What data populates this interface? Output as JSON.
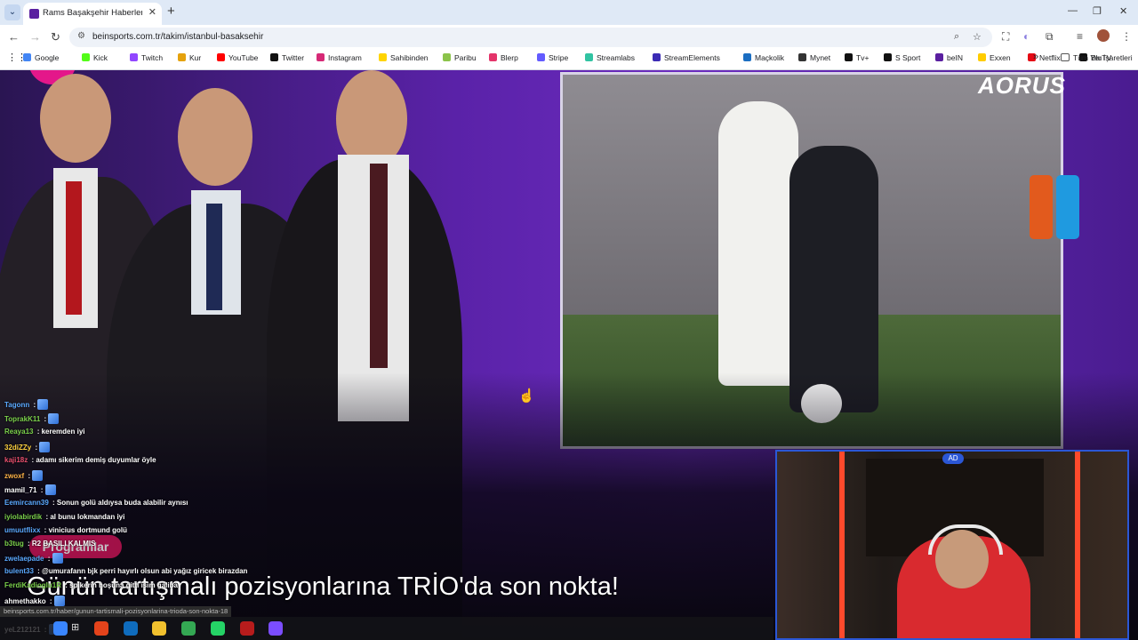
{
  "browser": {
    "tab_title": "Rams Başakşehir Haberleri - Tra",
    "new_tab": "+",
    "url": "beinsports.com.tr/takim/istanbul-basaksehir",
    "bookmarks": [
      {
        "label": "Google",
        "color": "#4285f4"
      },
      {
        "label": "Kick",
        "color": "#53fc18"
      },
      {
        "label": "Twitch",
        "color": "#9146ff"
      },
      {
        "label": "Kur",
        "color": "#e5a20d"
      },
      {
        "label": "YouTube",
        "color": "#ff0000"
      },
      {
        "label": "Twitter",
        "color": "#111111"
      },
      {
        "label": "Instagram",
        "color": "#d62976"
      },
      {
        "label": "Sahibinden",
        "color": "#ffd400"
      },
      {
        "label": "Paribu",
        "color": "#8bc34a"
      },
      {
        "label": "Blerp",
        "color": "#e4346a"
      },
      {
        "label": "Stripe",
        "color": "#635bff"
      },
      {
        "label": "Streamlabs",
        "color": "#31c3a2"
      },
      {
        "label": "StreamElements",
        "color": "#3b2bb5"
      },
      {
        "label": "Maçkolik",
        "color": "#1b6ec2"
      },
      {
        "label": "Mynet",
        "color": "#333333"
      },
      {
        "label": "Tv+",
        "color": "#111111"
      },
      {
        "label": "S Sport",
        "color": "#111111"
      },
      {
        "label": "beIN",
        "color": "#5a1fa0"
      },
      {
        "label": "Exxen",
        "color": "#ffcc00"
      },
      {
        "label": "Netflix",
        "color": "#e50914"
      },
      {
        "label": "BluTV",
        "color": "#111111"
      }
    ],
    "all_bookmarks": "Tüm Yer İşaretleri"
  },
  "page": {
    "headline": "Günün tartışmalı pozisyonlarına TRİO'da son nokta!",
    "programs_button": "Programlar",
    "sponsor": "AORUS",
    "status_url": "beinsports.com.tr/haber/gunun-tartismali-pozisyonlarina-trioda-son-nokta-18"
  },
  "chat": [
    {
      "user": "Tagonn",
      "msg": "",
      "user_color": "#5aa9ff",
      "emote": true
    },
    {
      "user": "ToprakK11",
      "msg": "",
      "user_color": "#7bd14b",
      "emote": true
    },
    {
      "user": "Reaya13",
      "msg": "keremden iyi",
      "user_color": "#7bd14b",
      "emote": false
    },
    {
      "user": "32diZZy",
      "msg": "",
      "user_color": "#ffd23f",
      "emote": true
    },
    {
      "user": "kaji18z",
      "msg": "adamı sikerim demiş duyumlar öyle",
      "user_color": "#e94f6d",
      "emote": false
    },
    {
      "user": "zwoxf",
      "msg": "",
      "user_color": "#ffb347",
      "emote": true
    },
    {
      "user": "mamil_71",
      "msg": "",
      "user_color": "#ffffff",
      "emote": true
    },
    {
      "user": "Eemircann39",
      "msg": "Sonun golü aldıysa buda alabilir aynısı",
      "user_color": "#5aa9ff",
      "emote": false
    },
    {
      "user": "iyiolabirdik",
      "msg": "al bunu lokmandan iyi",
      "user_color": "#7bd14b",
      "emote": false
    },
    {
      "user": "umuutflixx",
      "msg": "vinicius dortmund golü",
      "user_color": "#5aa9ff",
      "emote": false
    },
    {
      "user": "b3tug",
      "msg": "R2 BASILI KALMIS",
      "user_color": "#7bd14b",
      "emote": false
    },
    {
      "user": "zwelaepade",
      "msg": "",
      "user_color": "#5aa9ff",
      "emote": true
    },
    {
      "user": "bulent33",
      "msg": "@umurafann bjk perri hayırlı olsun abi yağız giricek birazdan",
      "user_color": "#5aa9ff",
      "emote": false
    },
    {
      "user": "FerdiKadioglu1R",
      "msg": "spikerin hoşuna gitti isim galiba",
      "user_color": "#7bd14b",
      "emote": false
    },
    {
      "user": "ahmethakko",
      "msg": "",
      "user_color": "#ffffff",
      "emote": true
    },
    {
      "user": "yeL212121",
      "msg": "",
      "user_color": "#ffffff",
      "emote": true
    }
  ]
}
